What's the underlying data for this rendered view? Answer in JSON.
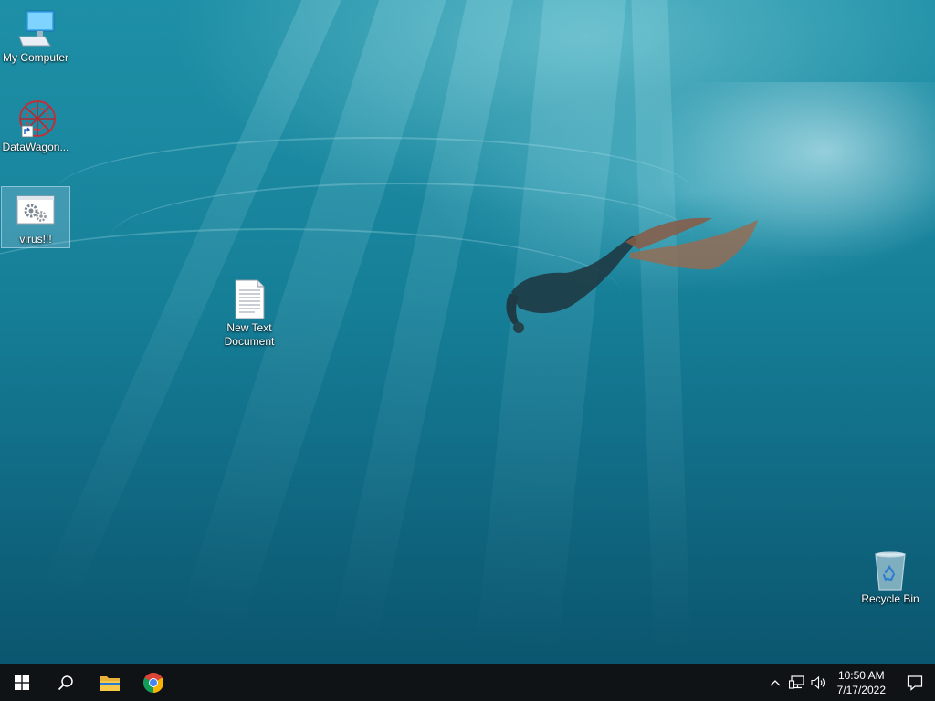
{
  "desktop": {
    "icons": [
      {
        "label": "My Computer",
        "icon": "monitor-icon"
      },
      {
        "label": "DataWagon...",
        "icon": "datawagon-shortcut-icon"
      },
      {
        "label": "virus!!!",
        "icon": "gears-program-icon"
      },
      {
        "label": "New Text Document",
        "icon": "text-document-icon"
      },
      {
        "label": "Recycle Bin",
        "icon": "recycle-bin-icon"
      }
    ]
  },
  "taskbar": {
    "pinned": [
      "windows-start-icon",
      "search-icon",
      "file-explorer-icon",
      "chrome-icon"
    ],
    "tray": {
      "time": "10:50 AM",
      "date": "7/17/2022",
      "icons": [
        "chevron-up-icon",
        "network-icon",
        "volume-icon",
        "notification-icon"
      ]
    }
  },
  "colors": {
    "taskbar": "#101315",
    "water_top": "#1d8fa6",
    "water_bottom": "#0b566f"
  }
}
